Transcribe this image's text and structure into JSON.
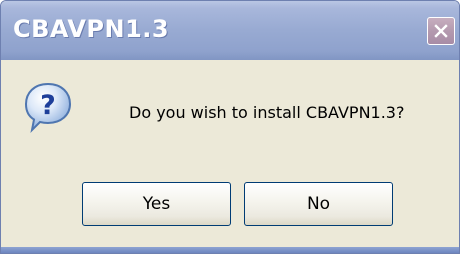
{
  "window": {
    "title": "CBAVPN1.3",
    "close_icon": "close-icon"
  },
  "dialog": {
    "icon": "question-icon",
    "message": "Do you wish to install CBAVPN1.3?",
    "buttons": {
      "yes_label": "Yes",
      "no_label": "No"
    }
  },
  "colors": {
    "titlebar": "#98aad2",
    "body": "#ece9d8",
    "button_border": "#003c74"
  }
}
